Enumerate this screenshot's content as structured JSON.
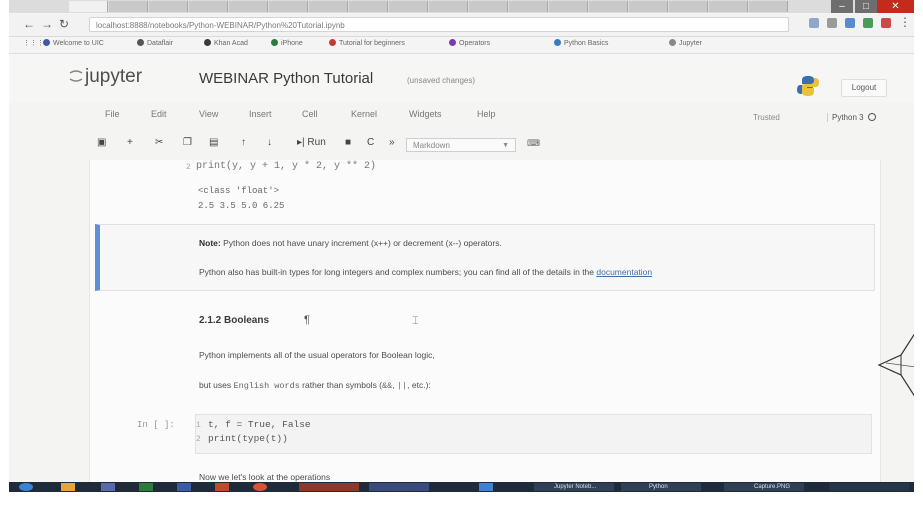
{
  "browser": {
    "url": "localhost:8888/notebooks/Python-WEBINAR/Python%20Tutorial.ipynb",
    "bookmarks": [
      "Welcome to UIC",
      "Dataflair",
      "Khan Acad",
      "iPhone",
      "Tutorial for beginners",
      "Operators",
      "Python Basics",
      "Jupyter"
    ]
  },
  "header": {
    "logo_text": "jupyter",
    "notebook_title": "WEBINAR Python Tutorial",
    "save_status": "(unsaved changes)",
    "logout_label": "Logout"
  },
  "menu": {
    "items": [
      "File",
      "Edit",
      "View",
      "Insert",
      "Cell",
      "Kernel",
      "Widgets",
      "Help"
    ],
    "trusted_label": "Trusted",
    "kernel_name": "Python 3"
  },
  "toolbar": {
    "run_label": "Run",
    "cell_type": "Markdown"
  },
  "notebook": {
    "prev_code_line": "print(y, y + 1, y * 2, y ** 2)",
    "prev_code_line_number": "2",
    "output_type": "<class 'float'>",
    "output_values": "2.5 3.5 5.0 6.25",
    "note_label": "Note:",
    "note_text": " Python does not have unary increment (x++) or decrement (x--) operators.",
    "note2_text": "Python also has built-in types for long integers and complex numbers; you can find all of the details in the ",
    "note2_link": "documentation",
    "heading": "2.1.2 Booleans",
    "heading_anchor": "¶",
    "para1": "Python implements all of the usual operators for Boolean logic,",
    "para2_pre": "but uses ",
    "para2_code": "English words",
    "para2_mid": " rather than symbols (",
    "para2_sym1": "&&",
    "para2_sep": ", ",
    "para2_sym2": "||",
    "para2_post": ", etc.):",
    "prompt": "In [ ]:",
    "code_line1": "t, f = True, False",
    "code_line2": "print(type(t))",
    "line_no1": "1",
    "line_no2": "2",
    "para3": "Now we let's look at the operations"
  },
  "taskbar": {
    "items": [
      "Jupyter Noteb...",
      "Python",
      "Capture.PNG"
    ]
  },
  "colors": {
    "selected_cell_border": "#5f8fd6",
    "close_button": "#c42b1c",
    "taskbar": "#1f2b3a"
  }
}
